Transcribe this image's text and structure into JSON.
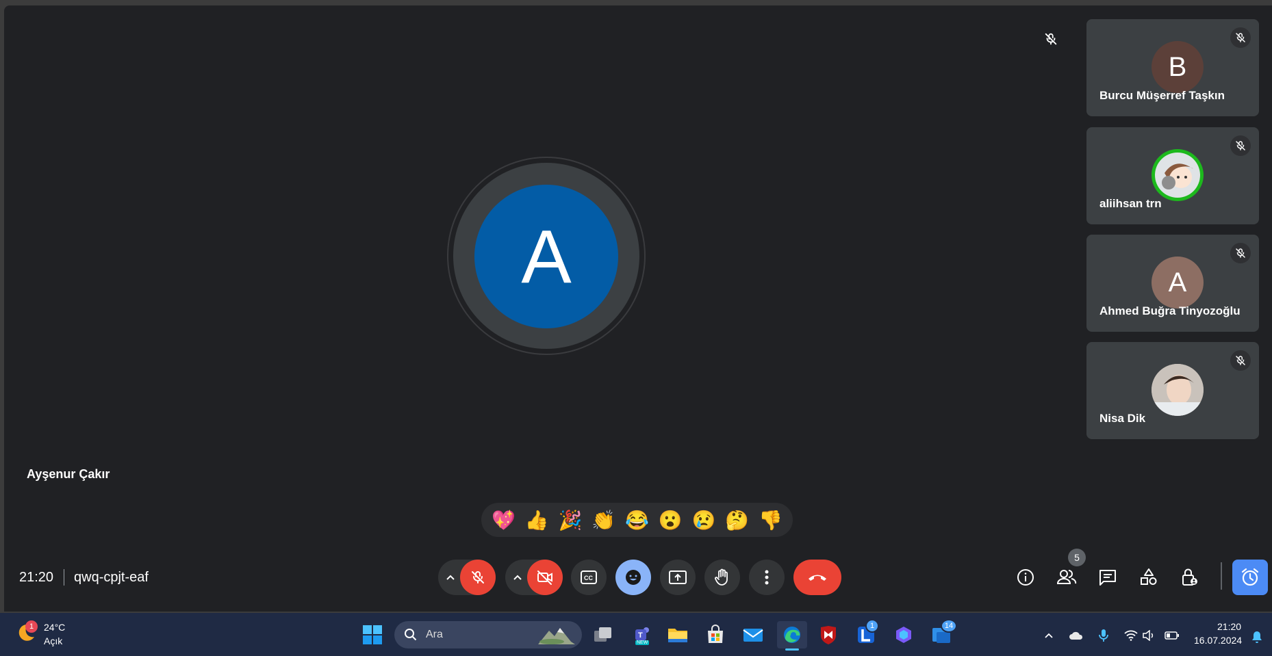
{
  "main": {
    "speaker_name": "Ayşenur Çakır",
    "speaker_initial": "A",
    "avatar_color": "#035ca6"
  },
  "participants": [
    {
      "name": "Burcu Müşerref Taşkın",
      "initial": "B",
      "color": "#5c4039"
    },
    {
      "name": "aliihsan trn",
      "initial": "",
      "color": "#cfd8dc"
    },
    {
      "name": "Ahmed Buğra Tinyozoğlu",
      "initial": "A",
      "color": "#8d6e63"
    },
    {
      "name": "Nisa Dik",
      "initial": "",
      "color": "#b0a49a"
    }
  ],
  "reactions": [
    "💖",
    "👍",
    "🎉",
    "👏",
    "😂",
    "😮",
    "😢",
    "🤔",
    "👎"
  ],
  "bottom_bar": {
    "time": "21:20",
    "meeting_code": "qwq-cpjt-eaf",
    "participants_count": "5"
  },
  "taskbar": {
    "weather_temp": "24°C",
    "weather_condition": "Açık",
    "weather_badge": "1",
    "search_placeholder": "Ara",
    "teams_label": "NEW",
    "l_badge": "1",
    "todo_badge": "14",
    "clock_time": "21:20",
    "clock_date": "16.07.2024"
  },
  "colors": {
    "background": "#202124",
    "tile": "#3c4043",
    "danger": "#ea4335",
    "accent": "#8ab4f8",
    "taskbar": "#1f2a44"
  }
}
